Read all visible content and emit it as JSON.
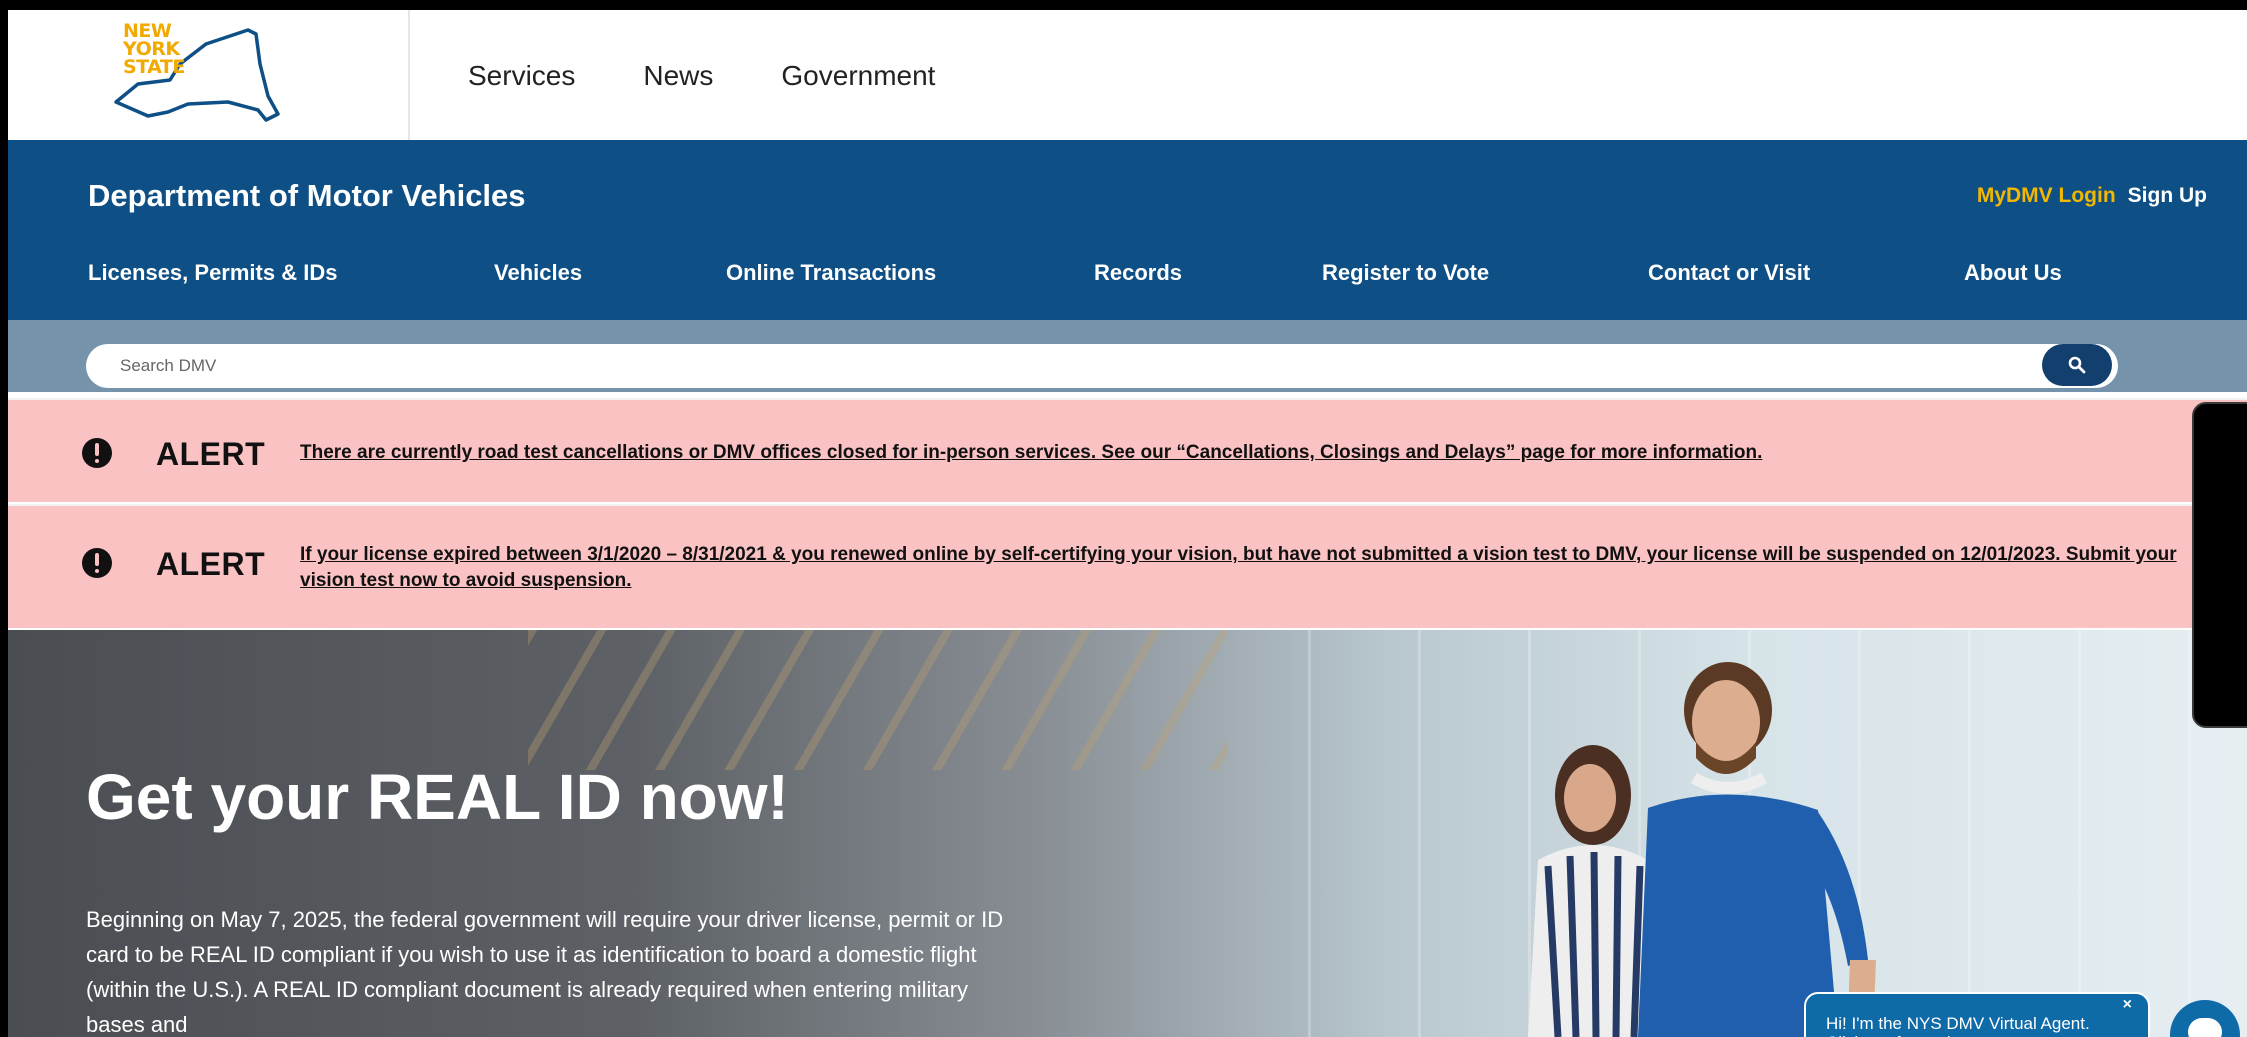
{
  "state_logo": {
    "text_lines": [
      "NEW",
      "YORK",
      "STATE"
    ],
    "color": "#f2a900"
  },
  "top_nav": {
    "items": [
      "Services",
      "News",
      "Government"
    ]
  },
  "agency": {
    "title": "Department of Motor Vehicles",
    "login_label": "MyDMV Login",
    "signup_label": "Sign Up",
    "nav": [
      "Licenses, Permits & IDs",
      "Vehicles",
      "Online Transactions",
      "Records",
      "Register to Vote",
      "Contact or Visit",
      "About Us"
    ]
  },
  "search": {
    "placeholder": "Search DMV"
  },
  "alerts": [
    {
      "label": "ALERT",
      "text": "There are currently road test cancellations or DMV offices closed for in-person services. See our “Cancellations, Closings and Delays” page for more information."
    },
    {
      "label": "ALERT",
      "text": "If your license expired between 3/1/2020 – 8/31/2021 & you renewed online by self-certifying your vision, but have not submitted a vision test to DMV, your license will be suspended on 12/01/2023. Submit your vision test now to avoid suspension."
    }
  ],
  "hero": {
    "title": "Get your REAL ID now!",
    "body": "Beginning on May 7, 2025, the federal government will require your driver license, permit or ID card to be REAL ID compliant if you wish to use it as identification to board a domestic flight (within the U.S.). A REAL ID compliant document is already required when entering military bases and"
  },
  "chat": {
    "bubble_text": "Hi! I'm the NYS DMV Virtual Agent. Click me for assistance.",
    "close_label": "×"
  },
  "colors": {
    "agency_blue": "#0e4f86",
    "search_bar": "#7594ab",
    "alert_pink": "#fbc2c4",
    "login_gold": "#f2b700"
  }
}
